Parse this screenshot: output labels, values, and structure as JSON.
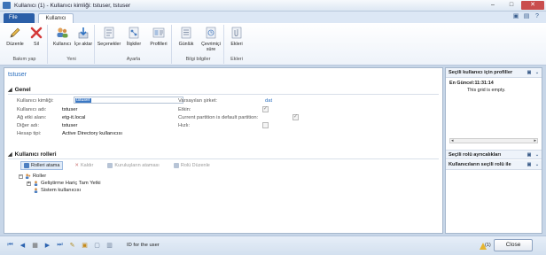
{
  "window": {
    "title": "Kullanıcı (1) - Kullanıcı kimliği: tstuser, tstuser"
  },
  "tabs": {
    "file": "File",
    "active": "Kullanıcı"
  },
  "ribbon": {
    "groups": [
      {
        "label": "Bakım yap",
        "buttons": [
          "Düzenle",
          "Sil"
        ]
      },
      {
        "label": "Yeni",
        "buttons": [
          "Kullanıcı",
          "İçe aktar"
        ]
      },
      {
        "label": "Ayarla",
        "buttons": [
          "Seçenekler",
          "İlişkiler",
          "Profilleri"
        ]
      },
      {
        "label": "Bilgi bilgiler",
        "buttons": [
          "Günlük",
          "Çevrimiçi süre"
        ]
      },
      {
        "label": "Ekleri",
        "buttons": [
          "Ekleri"
        ]
      }
    ]
  },
  "page": {
    "title": "tstuser",
    "general": {
      "header": "Genel",
      "fields": {
        "user_id_label": "Kullanıcı kimliği:",
        "user_id_value": "tstuser",
        "user_name_label": "Kullanıcı adı:",
        "user_name_value": "tstuser",
        "domain_label": "Ağ etki alanı:",
        "domain_value": "etg-it.local",
        "alias_label": "Diğer adı:",
        "alias_value": "tstuser",
        "account_type_label": "Hesap tipi:",
        "account_type_value": "Active Directory kullanıcısı",
        "company_label": "Varsayılan şirket:",
        "company_value": "dat",
        "enabled_label": "Etkin:",
        "partition_label": "Current partition is default partition:",
        "speed_label": "Hızlı:"
      }
    },
    "roles": {
      "header": "Kullanıcı rolleri",
      "toolbar": {
        "assign": "Rolleri atama",
        "remove": "Kaldır",
        "org_assign": "Kuruluşların ataması",
        "edit": "Rolü Düzenle"
      },
      "tree": {
        "root": "Roller",
        "items": [
          "Geliştirme Hariç Tam Yetki",
          "Sistem kullanıcısı"
        ]
      }
    }
  },
  "factbox": {
    "profiles_header": "Seçili kullanıcı için profiller",
    "latest": "En Güncel:11:31:14",
    "empty": "This grid is empty.",
    "role_details_header": "Seçili rolü ayrıcalıkları",
    "users_header": "Kullanıcıların seçili rolü ile"
  },
  "status": {
    "text": "ID for the user",
    "notifications": "(1)",
    "close": "Close"
  }
}
